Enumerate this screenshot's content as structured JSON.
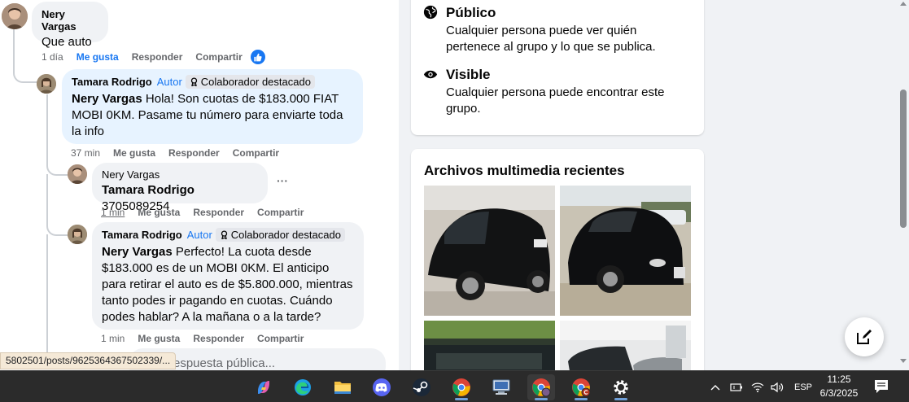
{
  "comments": {
    "c1": {
      "author": "Nery Vargas",
      "text": "Que auto",
      "time": "1 día",
      "like": "Me gusta",
      "reply": "Responder",
      "share": "Compartir"
    },
    "c2": {
      "author": "Tamara Rodrigo",
      "author_tag": "Autor",
      "badge": "Colaborador destacado",
      "mention": "Nery Vargas",
      "text": " Hola! Son cuotas de $183.000 FIAT MOBI 0KM. Pasame tu número para enviarte toda la info",
      "time": "37 min",
      "like": "Me gusta",
      "reply": "Responder",
      "share": "Compartir"
    },
    "c3": {
      "author": "Nery Vargas",
      "mention": "Tamara Rodrigo",
      "text": " 3705089254",
      "time": "1 min",
      "like": "Me gusta",
      "reply": "Responder",
      "share": "Compartir",
      "more": "···"
    },
    "c4": {
      "author": "Tamara Rodrigo",
      "author_tag": "Autor",
      "badge": "Colaborador destacado",
      "mention": "Nery Vargas",
      "text": " Perfecto! La cuota desde $183.000 es de un MOBI 0KM. El anticipo para retirar el auto es de $5.800.000, mientras tanto podes ir pagando en cuotas. Cuándo podes hablar? A la mañana o a la tarde?",
      "time": "1 min",
      "like": "Me gusta",
      "reply": "Responder",
      "share": "Compartir"
    }
  },
  "reply_placeholder": "respuesta pública...",
  "status_url": "5802501/posts/9625364367502339/...",
  "group_info": {
    "public_title": "Público",
    "public_desc": "Cualquier persona puede ver quién pertenece al grupo y lo que se publica.",
    "visible_title": "Visible",
    "visible_desc": "Cualquier persona puede encontrar este grupo."
  },
  "media": {
    "title": "Archivos multimedia recientes"
  },
  "taskbar": {
    "apps": [
      "copilot-icon",
      "edge-icon",
      "file-explorer-icon",
      "discord-icon",
      "steam-icon",
      "chrome-icon",
      "remote-desktop-icon",
      "chrome-profile-icon",
      "chrome-profile-c-icon",
      "settings-icon"
    ],
    "lang": "ESP",
    "time": "11:25",
    "date": "6/3/2025"
  },
  "colors": {
    "accent": "#1877f2",
    "highlight": "#e7f3ff",
    "taskbar": "#2b2b2b"
  }
}
